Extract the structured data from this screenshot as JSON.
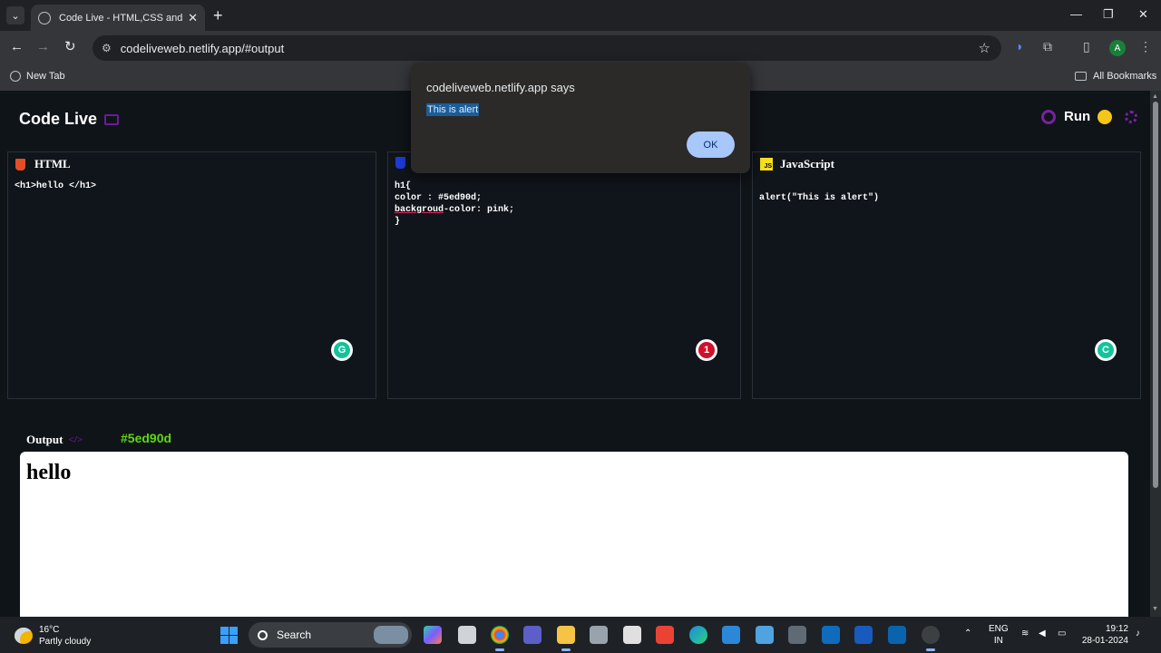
{
  "browser": {
    "tab_title": "Code Live - HTML,CSS and JavaScript",
    "tab_close": "✕",
    "new_tab": "+",
    "url": "codeliveweb.netlify.app/#output",
    "bookmark_new_tab": "New Tab",
    "bookmark_all": "All Bookmarks",
    "profile_initial": "A",
    "window_controls": [
      "—",
      "❐",
      "✕"
    ]
  },
  "app": {
    "title": "Code Live",
    "run_label": "Run"
  },
  "panels": {
    "html": {
      "title": "HTML",
      "code": "<h1>hello </h1>"
    },
    "css": {
      "code_line1": "h1{",
      "code_line2": "color : #5ed90d;",
      "code_line3_err": "backgroud",
      "code_line3_rest": "-color: pink;",
      "code_line4": "}",
      "grammarly_count": "1"
    },
    "js": {
      "title": "JavaScript",
      "code": "alert(\"This is alert\")",
      "badge": "JS"
    }
  },
  "output": {
    "label": "Output",
    "color_value": "#5ed90d",
    "heading": "hello"
  },
  "dialog": {
    "title": "codeliveweb.netlify.app says",
    "message": "This is alert",
    "ok_label": "OK"
  },
  "taskbar": {
    "temperature": "16°C",
    "weather": "Partly cloudy",
    "search_placeholder": "Search",
    "lang_line1": "ENG",
    "lang_line2": "IN",
    "time": "19:12",
    "date": "28-01-2024"
  }
}
